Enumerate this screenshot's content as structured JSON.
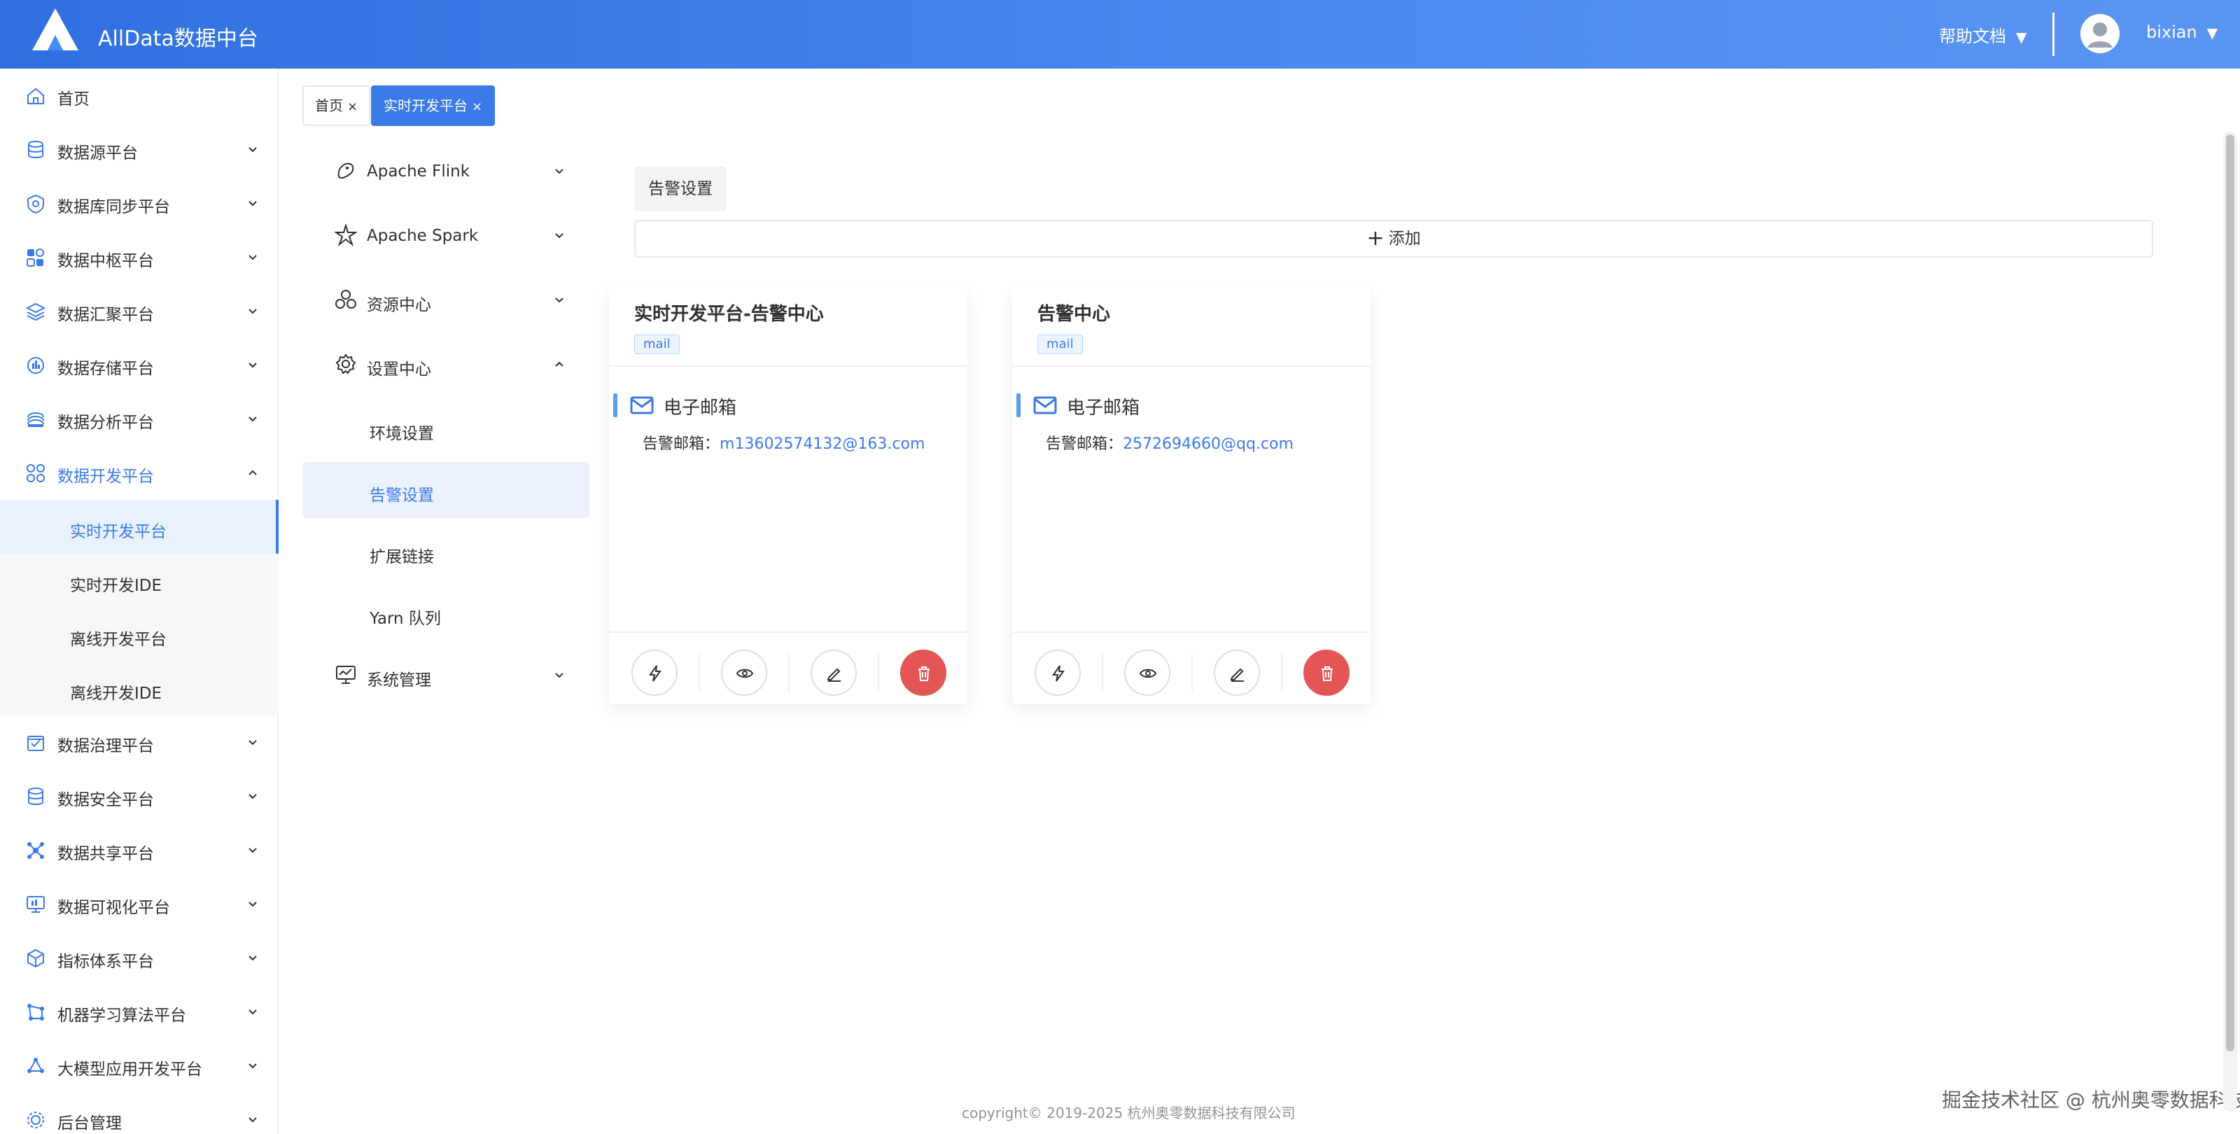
{
  "header": {
    "app_title": "AllData数据中台",
    "help_label": "帮助文档",
    "username": "bixian",
    "caret": "▼"
  },
  "sidebar": {
    "items": [
      {
        "label": "首页",
        "icon": "home-icon"
      },
      {
        "label": "数据源平台",
        "icon": "database-icon"
      },
      {
        "label": "数据库同步平台",
        "icon": "sync-icon"
      },
      {
        "label": "数据中枢平台",
        "icon": "hub-icon"
      },
      {
        "label": "数据汇聚平台",
        "icon": "layers-icon"
      },
      {
        "label": "数据存储平台",
        "icon": "storage-icon"
      },
      {
        "label": "数据分析平台",
        "icon": "analysis-icon"
      },
      {
        "label": "数据开发平台",
        "icon": "dev-icon"
      },
      {
        "label": "数据治理平台",
        "icon": "governance-icon"
      },
      {
        "label": "数据安全平台",
        "icon": "security-icon"
      },
      {
        "label": "数据共享平台",
        "icon": "share-icon"
      },
      {
        "label": "数据可视化平台",
        "icon": "visual-icon"
      },
      {
        "label": "指标体系平台",
        "icon": "metrics-icon"
      },
      {
        "label": "机器学习算法平台",
        "icon": "ml-icon"
      },
      {
        "label": "大模型应用开发平台",
        "icon": "llm-icon"
      },
      {
        "label": "后台管理",
        "icon": "admin-icon"
      }
    ],
    "sub_items": [
      {
        "label": "实时开发平台"
      },
      {
        "label": "实时开发IDE"
      },
      {
        "label": "离线开发平台"
      },
      {
        "label": "离线开发IDE"
      }
    ]
  },
  "tabs": [
    {
      "label": "首页"
    },
    {
      "label": "实时开发平台"
    }
  ],
  "tab_close": "×",
  "menu2": {
    "items": [
      {
        "label": "Apache Flink",
        "icon": "flink-icon"
      },
      {
        "label": "Apache Spark",
        "icon": "spark-icon"
      },
      {
        "label": "资源中心",
        "icon": "resource-icon"
      },
      {
        "label": "设置中心",
        "icon": "settings-icon"
      },
      {
        "label": "系统管理",
        "icon": "system-icon"
      }
    ],
    "sub_items": [
      {
        "label": "环境设置"
      },
      {
        "label": "告警设置"
      },
      {
        "label": "扩展链接"
      },
      {
        "label": "Yarn 队列"
      }
    ]
  },
  "content": {
    "section_label": "告警设置",
    "add_label": "添加",
    "add_plus": "+",
    "cards": [
      {
        "title": "实时开发平台-告警中心",
        "tag": "mail",
        "channel": "电子邮箱",
        "email_label": "告警邮箱：",
        "email_value": "m13602574132@163.com"
      },
      {
        "title": "告警中心",
        "tag": "mail",
        "channel": "电子邮箱",
        "email_label": "告警邮箱：",
        "email_value": "2572694660@qq.com"
      }
    ]
  },
  "footer": "copyright© 2019-2025 杭州奥零数据科技有限公司",
  "watermark": "掘金技术社区 @ 杭州奥零数据科技",
  "colors": {
    "accent": "#3b7ae8",
    "danger": "#e45656",
    "header_start": "#2f6fe0",
    "header_end": "#5b95f2"
  }
}
